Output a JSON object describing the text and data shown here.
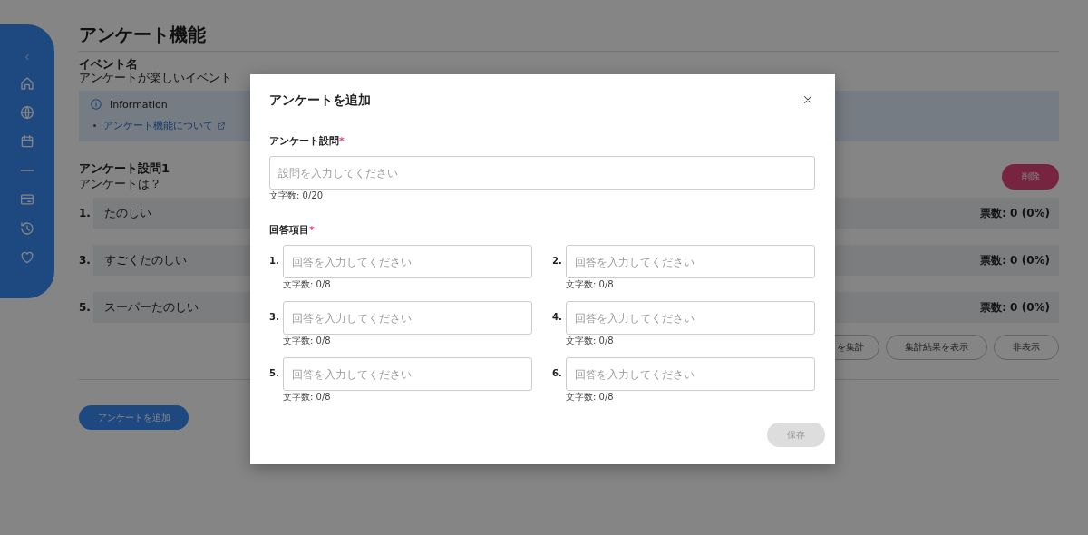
{
  "page": {
    "title": "アンケート機能",
    "event_label": "イベント名",
    "event_name": "アンケートが楽しいイベント",
    "info": {
      "title": "Information",
      "links": [
        {
          "text": "アンケート機能について"
        }
      ]
    },
    "question": {
      "heading": "アンケート設問1",
      "text": "アンケートは？",
      "delete_button": "削除",
      "options": [
        {
          "number": "1.",
          "text": "たのしい",
          "votes": "票数: 0 (0%)"
        },
        {
          "number": "3.",
          "text": "すごくたのしい",
          "votes": "票数: 0 (0%)"
        },
        {
          "number": "5.",
          "text": "スーパーたのしい",
          "votes": "票数: 0 (0%)"
        }
      ],
      "buttons": [
        {
          "label": "を集計"
        },
        {
          "label": "集計結果を表示"
        },
        {
          "label": "非表示"
        }
      ]
    },
    "add_button": "アンケートを追加"
  },
  "modal": {
    "title": "アンケートを追加",
    "question_field": {
      "label": "アンケート設問",
      "required_mark": "*",
      "placeholder": "設問を入力してください",
      "counter": "文字数: 0/20"
    },
    "answers_label": "回答項目",
    "answers_required_mark": "*",
    "answers": [
      {
        "number": "1.",
        "placeholder": "回答を入力してください",
        "counter": "文字数: 0/8"
      },
      {
        "number": "2.",
        "placeholder": "回答を入力してください",
        "counter": "文字数: 0/8"
      },
      {
        "number": "3.",
        "placeholder": "回答を入力してください",
        "counter": "文字数: 0/8"
      },
      {
        "number": "4.",
        "placeholder": "回答を入力してください",
        "counter": "文字数: 0/8"
      },
      {
        "number": "5.",
        "placeholder": "回答を入力してください",
        "counter": "文字数: 0/8"
      },
      {
        "number": "6.",
        "placeholder": "回答を入力してください",
        "counter": "文字数: 0/8"
      }
    ],
    "save_button": {
      "label": "保存",
      "disabled": true
    }
  }
}
